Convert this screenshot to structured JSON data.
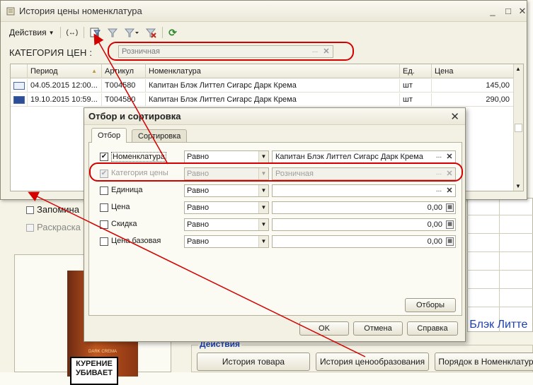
{
  "background": {
    "remember_label": "Запомина",
    "color_label": "Раскраска",
    "cig_brand_top": "DARK CREMA",
    "cig_warning": "КУРЕНИЕ УБИВАЕТ",
    "product_partial": "н Блэк Литте",
    "actions_group": "Действия",
    "buttons": [
      "История товара",
      "История ценообразования",
      "Порядок в Номенклатур"
    ]
  },
  "window": {
    "title": "История цены номенклатура",
    "toolbar": {
      "actions": "Действия"
    },
    "category_label": "КАТЕГОРИЯ ЦЕН :",
    "category_value": "Розничная",
    "table": {
      "columns": [
        "Период",
        "Артикул",
        "Номенклатура",
        "Ед.",
        "Цена"
      ],
      "rows": [
        {
          "period": "04.05.2015 12:00...",
          "article": "Т004580",
          "name": "Капитан Блэк Литтел Сигарс Дарк Крема",
          "unit": "шт",
          "price": "145,00"
        },
        {
          "period": "19.10.2015 10:59...",
          "article": "Т004580",
          "name": "Капитан Блэк Литтел Сигарс Дарк Крема",
          "unit": "шт",
          "price": "290,00"
        }
      ]
    }
  },
  "dialog": {
    "title": "Отбор и сортировка",
    "tabs": [
      "Отбор",
      "Сортировка"
    ],
    "filters": [
      {
        "label": "Номенклатура",
        "checked": true,
        "cond": "Равно",
        "value": "Капитан Блэк Литтел Сигарс Дарк Крема"
      },
      {
        "label": "Категория цены",
        "checked": true,
        "cond": "Равно",
        "value": "Розничная"
      },
      {
        "label": "Единица",
        "checked": false,
        "cond": "Равно",
        "value": ""
      },
      {
        "label": "Цена",
        "checked": false,
        "cond": "Равно",
        "value": "0,00"
      },
      {
        "label": "Скидка",
        "checked": false,
        "cond": "Равно",
        "value": "0,00"
      },
      {
        "label": "Цена базовая",
        "checked": false,
        "cond": "Равно",
        "value": "0,00"
      }
    ],
    "selections_button": "Отборы",
    "ok_button": "OK",
    "cancel_button": "Отмена",
    "help_button": "Справка"
  },
  "colors": {
    "annotation": "#d40000",
    "accent_blue": "#1a3fb0"
  }
}
